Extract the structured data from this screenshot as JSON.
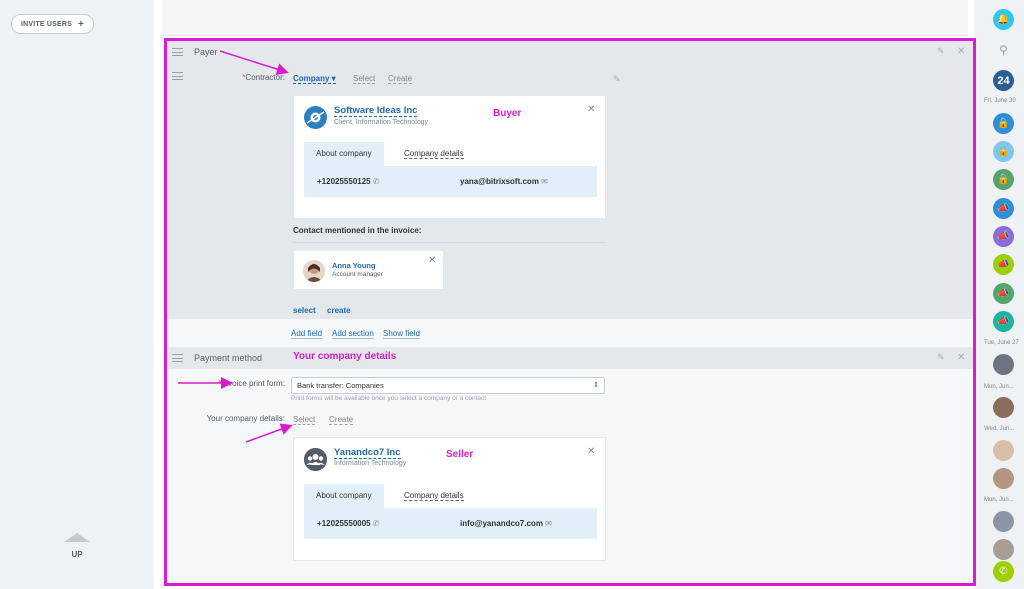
{
  "left": {
    "invite_label": "INVITE USERS",
    "up_label": "UP"
  },
  "payer": {
    "title": "Payer",
    "contractor_label": "Contractor:",
    "contractor_type": "Company",
    "select_label": "Select",
    "create_label": "Create",
    "company": {
      "name": "Software Ideas Inc",
      "sub": "Client, Information Technology",
      "tag": "Buyer",
      "tab_about": "About company",
      "tab_details": "Company details",
      "phone": "+12025550125",
      "email": "yana@bitrixsoft.com"
    },
    "contact_heading": "Contact mentioned in the invoice:",
    "contact": {
      "name": "Anna Young",
      "role": "Account manager"
    },
    "link_select": "select",
    "link_create": "create",
    "add_field": "Add field",
    "add_section": "Add section",
    "show_field": "Show field"
  },
  "payment": {
    "title": "Payment method",
    "tag": "Your company details",
    "print_form_label": "Invoice print form:",
    "print_form_value": "Bank transfer: Companies",
    "print_hint": "Print forms will be available once you select a company or a contact",
    "company_details_label": "Your company details:",
    "select_label": "Select",
    "create_label": "Create",
    "seller": {
      "name": "Yanandco7 Inc",
      "sub": "Information Technology",
      "tag": "Seller",
      "tab_about": "About company",
      "tab_details": "Company details",
      "phone": "+12025550005",
      "email": "info@yanandco7.com"
    }
  },
  "rightbar": {
    "counter": "24",
    "dates": [
      "Fri, June 30",
      "Tue, June 27",
      "Mon, Jun...",
      "Wed, Jun...",
      "Mon, Jun..."
    ],
    "colors": {
      "blue": "#2fc6f6",
      "navy": "#2b5f93",
      "green": "#55a56b",
      "purple": "#8b6dd8",
      "lime": "#9dcf00",
      "teal": "#1bb5a3",
      "lightblue": "#7fc7ec",
      "darkblue": "#2d8fd8"
    }
  },
  "accent": "#d71dce"
}
